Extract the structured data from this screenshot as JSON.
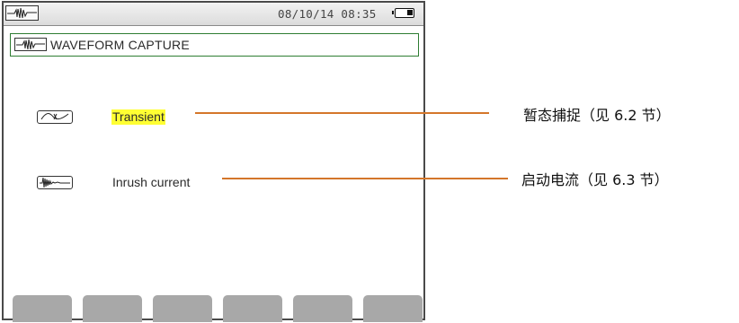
{
  "status_bar": {
    "datetime": "08/10/14 08:35",
    "mode_icon": "waveform-icon",
    "battery_icon": "battery-icon"
  },
  "screen": {
    "title": "WAVEFORM CAPTURE",
    "title_icon": "waveform-icon"
  },
  "menu": {
    "items": [
      {
        "label": "Transient",
        "icon": "transient-icon",
        "selected": true
      },
      {
        "label": "Inrush current",
        "icon": "inrush-icon",
        "selected": false
      }
    ]
  },
  "softkeys": [
    "",
    "",
    "",
    "",
    "",
    ""
  ],
  "callouts": [
    {
      "text": "暂态捕捉（见 6.2 节）"
    },
    {
      "text": "启动电流（见 6.3 节）"
    }
  ],
  "colors": {
    "selection_highlight": "#ffff33",
    "callout_line": "#d4762a",
    "title_border": "#2e7d32",
    "softkey": "#a8a8a8"
  }
}
